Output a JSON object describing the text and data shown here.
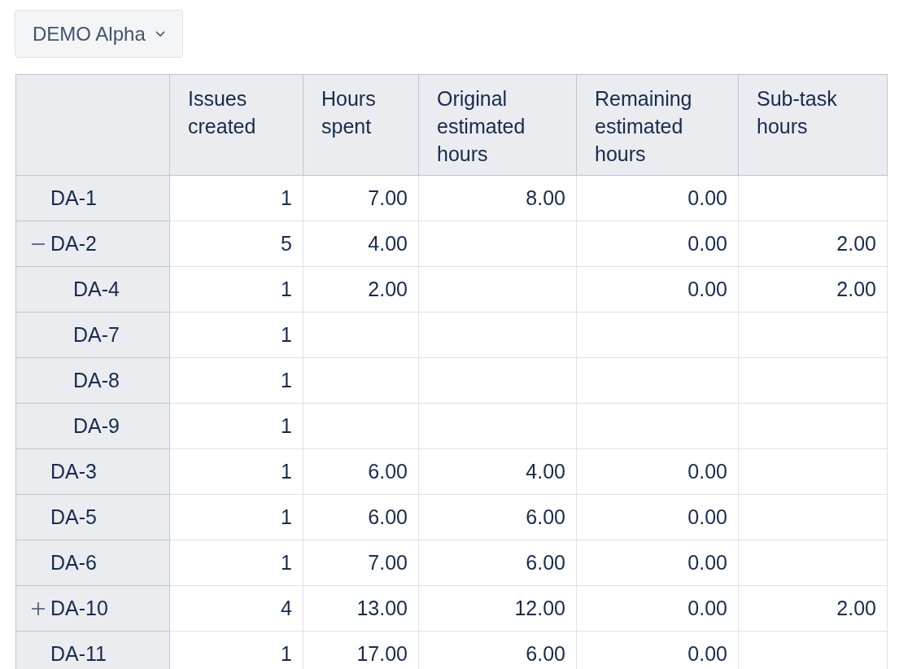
{
  "dropdown": {
    "label": "DEMO Alpha"
  },
  "table": {
    "columns": [
      "Issues created",
      "Hours spent",
      "Original estimated hours",
      "Remaining estimated hours",
      "Sub-task hours"
    ],
    "rows": [
      {
        "label": "DA-1",
        "cells": [
          "1",
          "7.00",
          "8.00",
          "0.00",
          ""
        ]
      },
      {
        "label": "DA-2",
        "expandable": true,
        "expanded": true,
        "cells": [
          "5",
          "4.00",
          "",
          "0.00",
          "2.00"
        ],
        "children": [
          {
            "label": "DA-4",
            "cells": [
              "1",
              "2.00",
              "",
              "0.00",
              "2.00"
            ]
          },
          {
            "label": "DA-7",
            "cells": [
              "1",
              "",
              "",
              "",
              ""
            ]
          },
          {
            "label": "DA-8",
            "cells": [
              "1",
              "",
              "",
              "",
              ""
            ]
          },
          {
            "label": "DA-9",
            "cells": [
              "1",
              "",
              "",
              "",
              ""
            ]
          }
        ]
      },
      {
        "label": "DA-3",
        "cells": [
          "1",
          "6.00",
          "4.00",
          "0.00",
          ""
        ]
      },
      {
        "label": "DA-5",
        "cells": [
          "1",
          "6.00",
          "6.00",
          "0.00",
          ""
        ]
      },
      {
        "label": "DA-6",
        "cells": [
          "1",
          "7.00",
          "6.00",
          "0.00",
          ""
        ]
      },
      {
        "label": "DA-10",
        "expandable": true,
        "expanded": false,
        "cells": [
          "4",
          "13.00",
          "12.00",
          "0.00",
          "2.00"
        ]
      },
      {
        "label": "DA-11",
        "cells": [
          "1",
          "17.00",
          "6.00",
          "0.00",
          ""
        ]
      }
    ]
  }
}
